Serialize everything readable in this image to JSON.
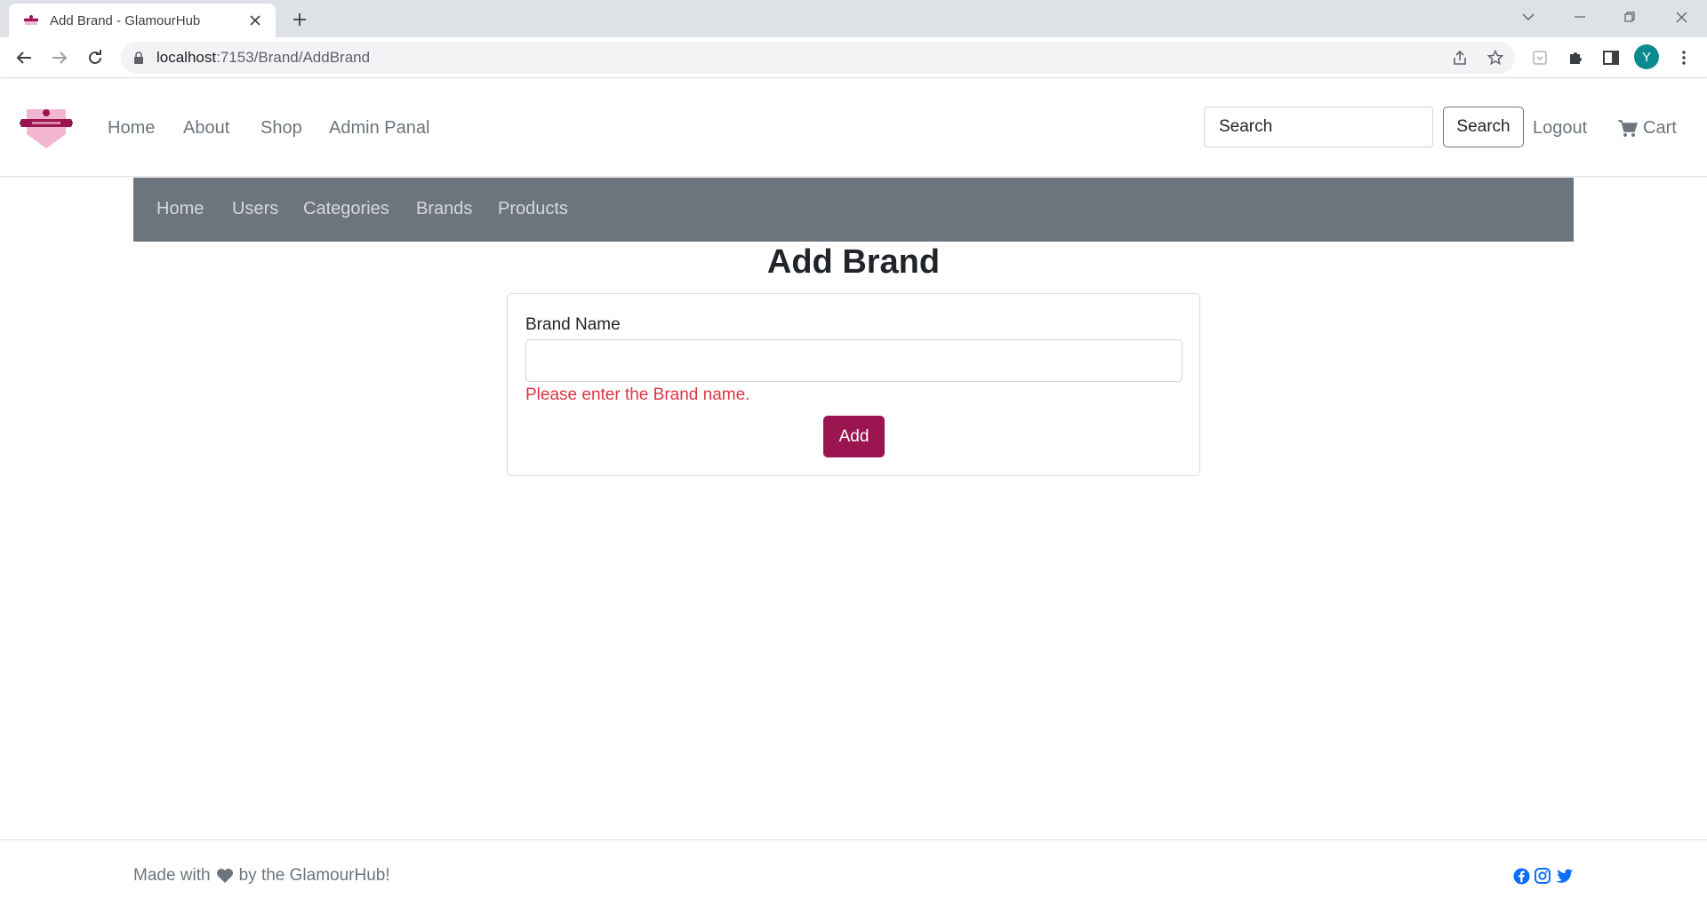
{
  "browser": {
    "tab_title": "Add Brand - GlamourHub",
    "url_host": "localhost",
    "url_rest": ":7153/Brand/AddBrand",
    "profile_initial": "Y"
  },
  "site_nav": {
    "links": [
      "Home",
      "About",
      "Shop",
      "Admin Panal"
    ],
    "search_placeholder": "Search",
    "search_button": "Search",
    "logout": "Logout",
    "cart": "Cart"
  },
  "admin_nav": {
    "links": [
      "Home",
      "Users",
      "Categories",
      "Brands",
      "Products"
    ]
  },
  "main": {
    "title": "Add Brand",
    "field_label": "Brand Name",
    "field_value": "",
    "error": "Please enter the Brand name.",
    "submit": "Add"
  },
  "footer": {
    "made_with": "Made with",
    "by": "by the GlamourHub!",
    "social": [
      "facebook-icon",
      "instagram-icon",
      "twitter-icon"
    ]
  },
  "colors": {
    "brand_accent": "#9b1550",
    "admin_nav_bg": "#6c757d",
    "error": "#dc3545",
    "social": "#0d6efd"
  }
}
